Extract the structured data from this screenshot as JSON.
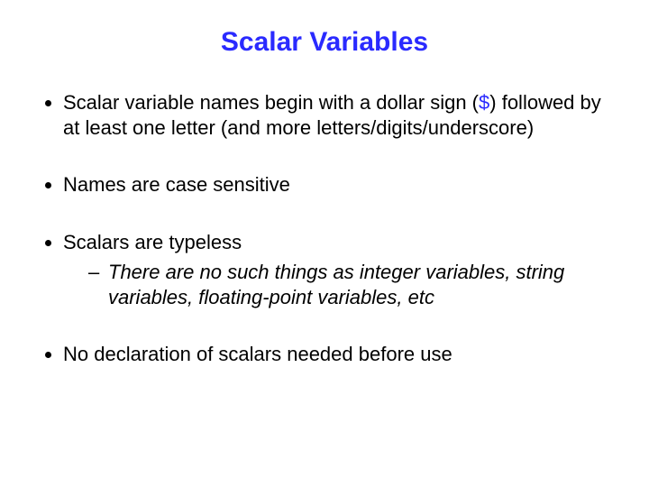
{
  "title": "Scalar Variables",
  "bullets": {
    "b1": {
      "pre": "Scalar variable names begin with a dollar sign (",
      "sym": "$",
      "post": ") followed by at least one letter (and more letters/digits/underscore)"
    },
    "b2": "Names are case sensitive",
    "b3": {
      "main": "Scalars are typeless",
      "sub": "There are no such things as integer variables, string variables, floating-point variables, etc"
    },
    "b4": "No declaration of scalars needed before use"
  }
}
